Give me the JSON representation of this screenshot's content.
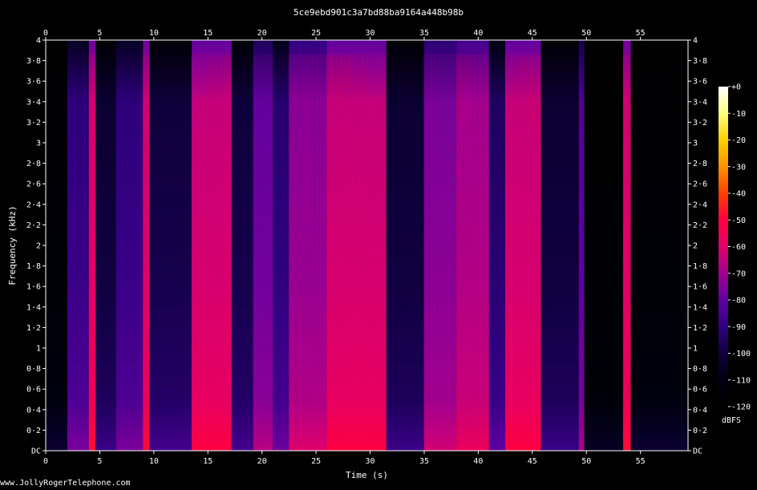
{
  "title": "5ce9ebd901c3a7bd88ba9164a448b98b",
  "watermark": "www.JollyRogerTelephone.com",
  "chart_data": {
    "type": "heatmap",
    "title": "5ce9ebd901c3a7bd88ba9164a448b98b",
    "xlabel": "Time (s)",
    "ylabel": "Frequency (kHz)",
    "xlim": [
      0,
      59.4
    ],
    "ylim": [
      0,
      4
    ],
    "x_ticks": [
      "0",
      "5",
      "10",
      "15",
      "20",
      "25",
      "30",
      "35",
      "40",
      "45",
      "50",
      "55"
    ],
    "y_ticks": [
      "DC",
      "0·2",
      "0·4",
      "0·6",
      "0·8",
      "1",
      "1·2",
      "1·4",
      "1·6",
      "1·8",
      "2",
      "2·2",
      "2·4",
      "2·6",
      "2·8",
      "3",
      "3·2",
      "3·4",
      "3·6",
      "3·8",
      "4"
    ],
    "colorbar": {
      "label": "dBFS",
      "range": [
        -120,
        0
      ],
      "ticks": [
        "+0",
        "-10",
        "-20",
        "-30",
        "-40",
        "-50",
        "-60",
        "-70",
        "-80",
        "-90",
        "-100",
        "-110",
        "-120"
      ],
      "colors": [
        "#ffffff",
        "#ffff80",
        "#ffd000",
        "#ff9000",
        "#ff4000",
        "#ff0040",
        "#e0006a",
        "#a00090",
        "#6000a0",
        "#300080",
        "#100040",
        "#000010",
        "#000000"
      ]
    },
    "segments": [
      {
        "start": 0.0,
        "end": 2.0,
        "level_dbfs": -115
      },
      {
        "start": 2.0,
        "end": 4.0,
        "level_dbfs": -88
      },
      {
        "start": 4.0,
        "end": 4.6,
        "level_dbfs": -60
      },
      {
        "start": 4.6,
        "end": 6.5,
        "level_dbfs": -100
      },
      {
        "start": 6.5,
        "end": 9.0,
        "level_dbfs": -88
      },
      {
        "start": 9.0,
        "end": 9.6,
        "level_dbfs": -60
      },
      {
        "start": 9.6,
        "end": 13.5,
        "level_dbfs": -98
      },
      {
        "start": 13.5,
        "end": 17.2,
        "level_dbfs": -62
      },
      {
        "start": 17.2,
        "end": 19.2,
        "level_dbfs": -98
      },
      {
        "start": 19.2,
        "end": 21.0,
        "level_dbfs": -78
      },
      {
        "start": 21.0,
        "end": 22.5,
        "level_dbfs": -90
      },
      {
        "start": 22.5,
        "end": 26.0,
        "level_dbfs": -72
      },
      {
        "start": 26.0,
        "end": 31.5,
        "level_dbfs": -62
      },
      {
        "start": 31.5,
        "end": 35.0,
        "level_dbfs": -100
      },
      {
        "start": 35.0,
        "end": 38.0,
        "level_dbfs": -74
      },
      {
        "start": 38.0,
        "end": 41.0,
        "level_dbfs": -68
      },
      {
        "start": 41.0,
        "end": 42.5,
        "level_dbfs": -92
      },
      {
        "start": 42.5,
        "end": 45.8,
        "level_dbfs": -62
      },
      {
        "start": 45.8,
        "end": 49.3,
        "level_dbfs": -100
      },
      {
        "start": 49.3,
        "end": 49.8,
        "level_dbfs": -80
      },
      {
        "start": 49.8,
        "end": 53.4,
        "level_dbfs": -118
      },
      {
        "start": 53.4,
        "end": 54.1,
        "level_dbfs": -60
      },
      {
        "start": 54.1,
        "end": 59.4,
        "level_dbfs": -115
      }
    ]
  }
}
